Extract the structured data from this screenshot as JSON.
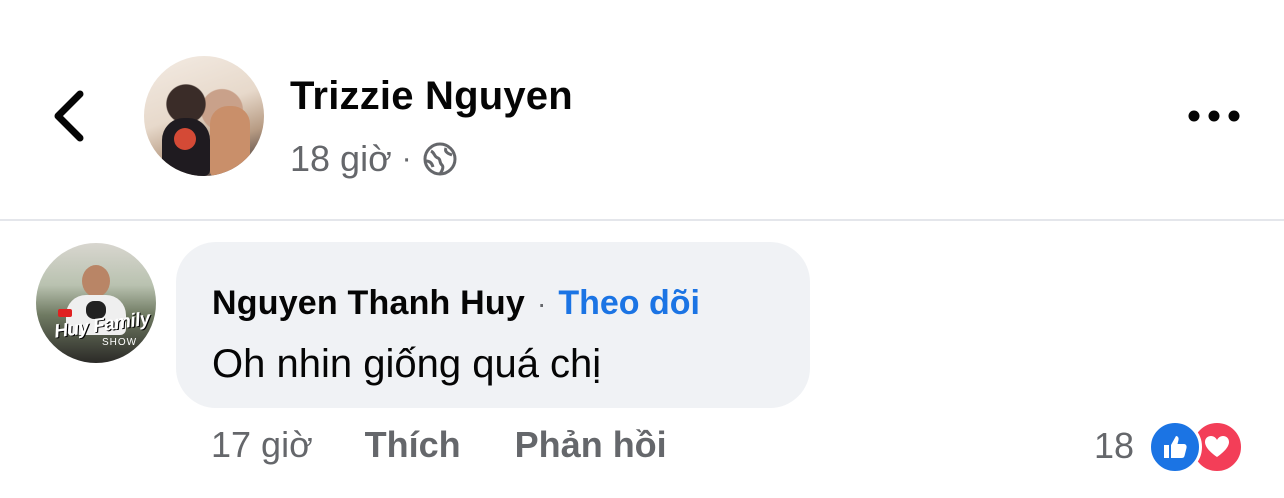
{
  "header": {
    "title": "Trizzie Nguyen",
    "time": "18 giờ",
    "separator": "·",
    "privacy_icon": "globe-icon"
  },
  "comment": {
    "author": "Nguyen Thanh Huy",
    "separator": "·",
    "follow_label": "Theo dõi",
    "text": "Oh nhin giống quá chị",
    "avatar_logo_text": "Huy Family",
    "avatar_logo_sub": "SHOW"
  },
  "actions": {
    "time": "17 giờ",
    "like_label": "Thích",
    "reply_label": "Phản hồi"
  },
  "reactions": {
    "count": "18",
    "icons": [
      "like-icon",
      "love-icon"
    ]
  },
  "colors": {
    "accent": "#1b74e4",
    "muted": "#65676b",
    "bubble": "#f0f2f5",
    "love": "#f33e58"
  }
}
